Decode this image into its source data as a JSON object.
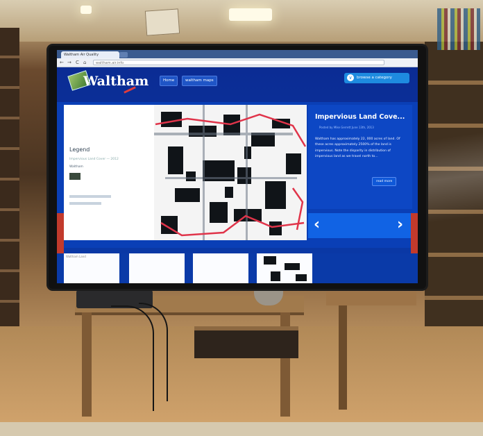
{
  "browser": {
    "tab_title": "Waltham Air Quality",
    "address": "waltham.air.info",
    "back_glyph": "←",
    "forward_glyph": "→",
    "reload_glyph": "C",
    "home_glyph": "⌂"
  },
  "site": {
    "logo_text": "Waltham",
    "nav": {
      "home": "Home",
      "maps": "waltham maps"
    },
    "category_button": "browse a category",
    "category_glyph": "∨"
  },
  "legend": {
    "title": "Legend",
    "subtitle": "Impervious Land Cover — 2012",
    "layer": "Waltham"
  },
  "story": {
    "title": "Impervious Land Cove...",
    "meta": "Posted by Mike Gerrett June 13th, 2013",
    "body": "Waltham has approximately 22, 000 acres of land. Of these acres approximately 2500% of the land is impervious. Note the disparity in distribution of impervious land as we travel north to...",
    "read_more": "read more"
  },
  "slider": {
    "prev_glyph": "‹",
    "next_glyph": "›"
  },
  "thumbnails": {
    "first_caption": "Waltham Land"
  },
  "colors": {
    "site_blue": "#0a3fb6",
    "accent_blue": "#1e8be0",
    "boundary_red": "#e0344a"
  }
}
